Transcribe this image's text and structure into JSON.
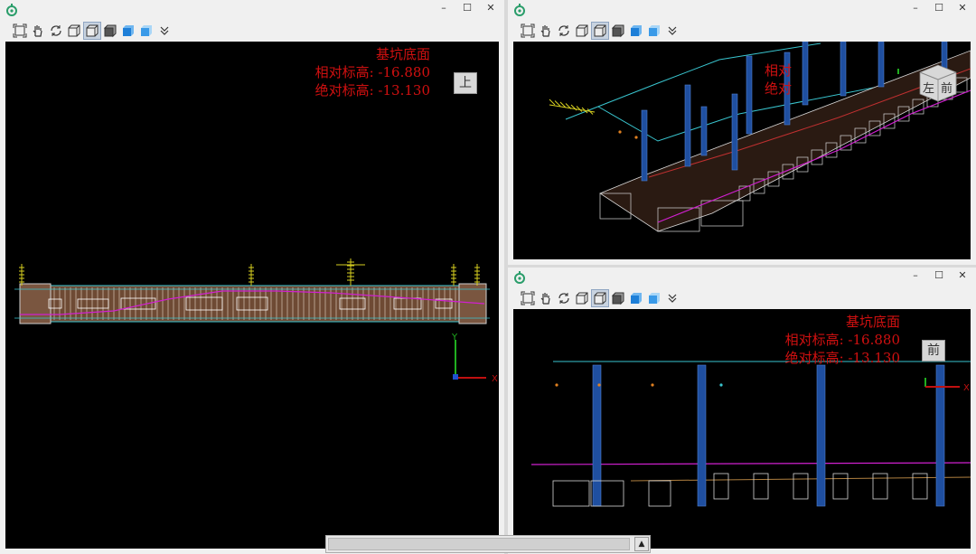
{
  "window_controls": {
    "minimize": "–",
    "maximize": "☐",
    "close": "✕"
  },
  "toolbar_icons": [
    "fit-view-icon",
    "pan-hand-icon",
    "rotate-icon",
    "wireframe-box-icon",
    "shaded-box-icon",
    "solid-box-icon",
    "blue-cube-icon",
    "blue-cube-light-icon",
    "more-chevron-icon"
  ],
  "active_tool_index": 4,
  "colors": {
    "label_red": "#d01010",
    "cyan": "#39c5cf",
    "magenta": "#d020d0",
    "column_blue": "#1f4fa0",
    "structure": "#d8d8d8"
  },
  "views": {
    "top": {
      "label_title": "基坑底面",
      "label_relative": "相对标高: -16.880",
      "label_absolute": "绝对标高: -13.130",
      "cube_face": "上",
      "axis_x": "X",
      "axis_y": "Y"
    },
    "iso": {
      "label_title": "相对",
      "label_relative": "绝对",
      "cube_left": "左",
      "cube_front": "前"
    },
    "front": {
      "label_title": "基坑底面",
      "label_relative": "相对标高: -16.880",
      "label_absolute": "绝对标高: -13.130",
      "cube_face": "前",
      "axis_x": "X"
    }
  },
  "scrollbar": {
    "arrow": "▲"
  }
}
